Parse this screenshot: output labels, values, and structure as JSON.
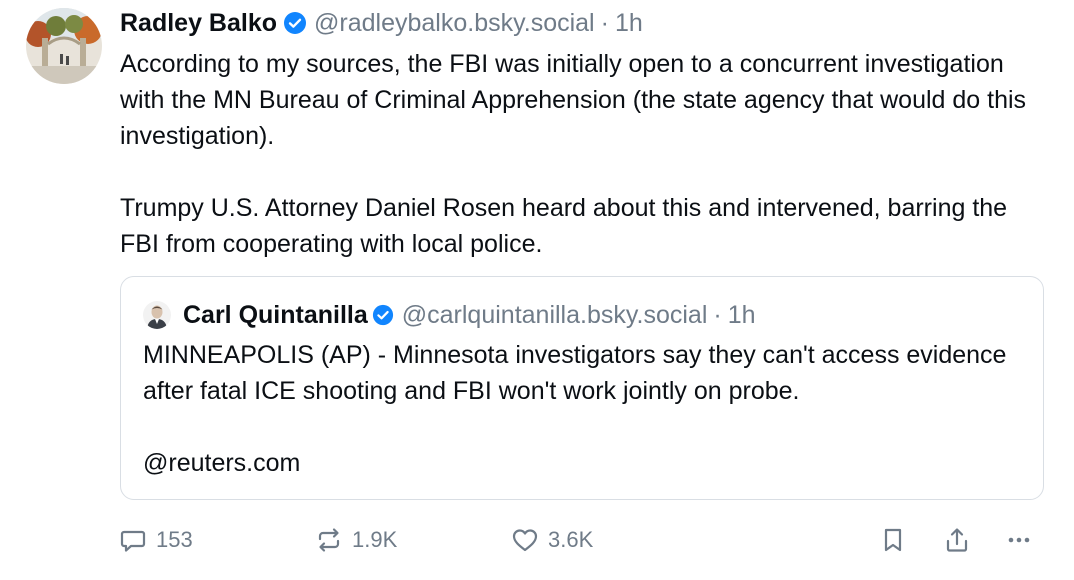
{
  "post": {
    "author_name": "Radley Balko",
    "handle": "@radleybalko.bsky.social",
    "separator": "·",
    "time": "1h",
    "avatar_icon": "campus-gate-photo-avatar",
    "verified_icon": "verified-check-icon",
    "paragraph_1": "According to my sources, the FBI was initially open to a concurrent investigation with the MN Bureau of Criminal Apprehension (the state agency that would do this investigation).",
    "paragraph_2": "Trumpy U.S. Attorney Daniel Rosen heard about this and intervened, barring the FBI from cooperating with local police."
  },
  "quote": {
    "author_name": "Carl Quintanilla",
    "handle": "@carlquintanilla.bsky.social",
    "separator": "·",
    "time": "1h",
    "avatar_icon": "person-portrait-avatar",
    "paragraph_1": "MINNEAPOLIS (AP) - Minnesota investigators say they can't access evidence after fatal ICE shooting and FBI won't work jointly on probe.",
    "paragraph_2": "@reuters.com"
  },
  "actions": {
    "reply_count": "153",
    "repost_count": "1.9K",
    "like_count": "3.6K"
  },
  "colors": {
    "accent_blue": "#1185fe",
    "muted_text": "#6f7b88",
    "border": "#d9dee4"
  }
}
